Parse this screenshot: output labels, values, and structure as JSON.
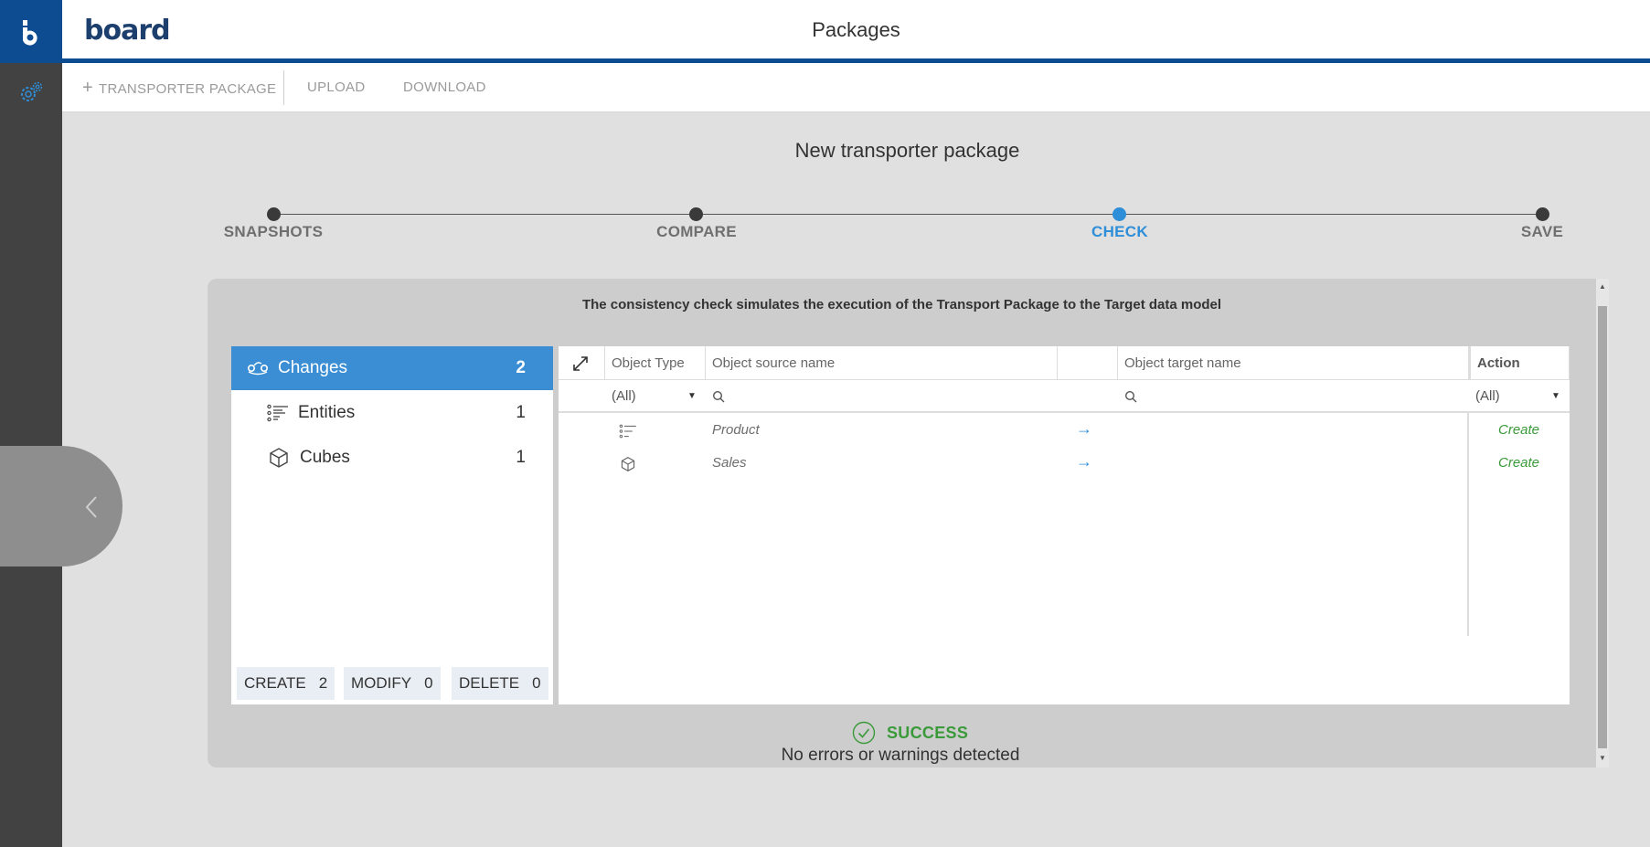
{
  "app": {
    "brand": "board",
    "page_title": "Packages"
  },
  "toolbar": {
    "add_label": "TRANSPORTER PACKAGE",
    "upload_label": "UPLOAD",
    "download_label": "DOWNLOAD"
  },
  "wizard": {
    "title": "New transporter package",
    "steps": [
      {
        "label": "SNAPSHOTS",
        "active": false
      },
      {
        "label": "COMPARE",
        "active": false
      },
      {
        "label": "CHECK",
        "active": true
      },
      {
        "label": "SAVE",
        "active": false
      }
    ]
  },
  "panel": {
    "caption": "The consistency check simulates the execution of the Transport Package to the Target data model"
  },
  "categories": {
    "items": [
      {
        "label": "Changes",
        "count": "2",
        "icon": "changes-icon",
        "selected": true
      },
      {
        "label": "Entities",
        "count": "1",
        "icon": "entity-list-icon",
        "selected": false
      },
      {
        "label": "Cubes",
        "count": "1",
        "icon": "cube-icon",
        "selected": false
      }
    ],
    "chips": [
      {
        "label": "CREATE",
        "count": "2"
      },
      {
        "label": "MODIFY",
        "count": "0"
      },
      {
        "label": "DELETE",
        "count": "0"
      }
    ]
  },
  "grid": {
    "columns": {
      "type": "Object Type",
      "source": "Object source name",
      "target": "Object target name",
      "action": "Action"
    },
    "filters": {
      "type": "(All)",
      "action": "(All)"
    },
    "rows": [
      {
        "icon": "entity-list-icon",
        "source": "Product",
        "target": "",
        "action": "Create"
      },
      {
        "icon": "cube-icon",
        "source": "Sales",
        "target": "",
        "action": "Create"
      }
    ]
  },
  "result": {
    "status": "SUCCESS",
    "message": "No errors or warnings detected"
  },
  "colors": {
    "brand": "#0e4c92",
    "accent": "#3b8ed4",
    "success": "#3a9a3a",
    "rail": "#424242"
  }
}
